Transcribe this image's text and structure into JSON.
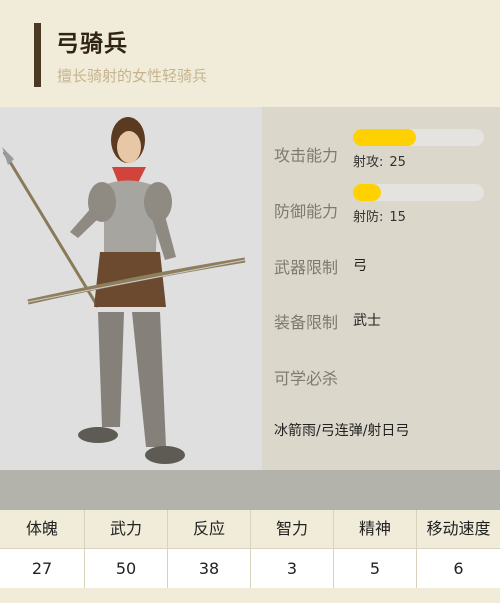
{
  "unit": {
    "name": "弓骑兵",
    "description": "擅长骑射的女性轻骑兵"
  },
  "attack": {
    "label": "攻击能力",
    "level": 0.48,
    "detail_label": "射攻:",
    "detail_value": "25"
  },
  "defense": {
    "label": "防御能力",
    "level": 0.21,
    "detail_label": "射防:",
    "detail_value": "15"
  },
  "weapon": {
    "label": "武器限制",
    "value": "弓"
  },
  "equipment": {
    "label": "装备限制",
    "value": "武士"
  },
  "skills": {
    "label": "可学必杀",
    "value": "冰箭雨/弓连弹/射日弓"
  },
  "stats": [
    {
      "label": "体魄",
      "value": "27"
    },
    {
      "label": "武力",
      "value": "50"
    },
    {
      "label": "反应",
      "value": "38"
    },
    {
      "label": "智力",
      "value": "3"
    },
    {
      "label": "精神",
      "value": "5"
    },
    {
      "label": "移动速度",
      "value": "6"
    }
  ],
  "colors": {
    "accent": "#4a3a25",
    "bar_fill": "#ffd100",
    "bar_track": "#e5e3e0"
  },
  "portrait_icon": "female-archer-portrait"
}
